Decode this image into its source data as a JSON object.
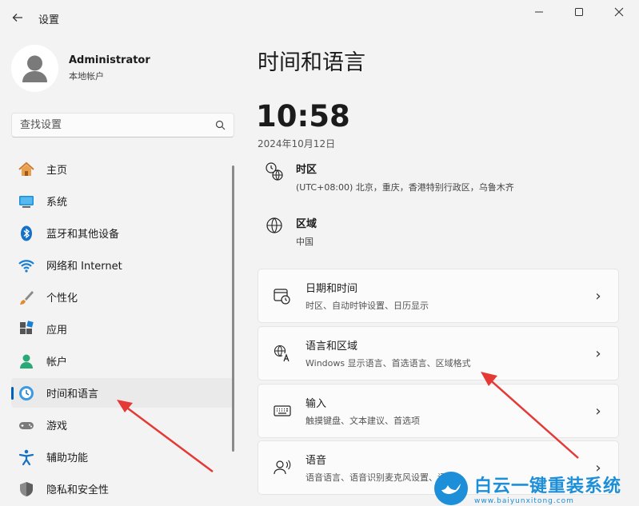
{
  "window": {
    "title": "设置",
    "controls": [
      "minimize",
      "maximize",
      "close"
    ]
  },
  "profile": {
    "name": "Administrator",
    "account_type": "本地帐户"
  },
  "search": {
    "placeholder": "查找设置"
  },
  "sidebar": {
    "items": [
      {
        "label": "主页",
        "icon": "home-icon",
        "active": false
      },
      {
        "label": "系统",
        "icon": "monitor-icon",
        "active": false
      },
      {
        "label": "蓝牙和其他设备",
        "icon": "bluetooth-icon",
        "active": false
      },
      {
        "label": "网络和 Internet",
        "icon": "wifi-icon",
        "active": false
      },
      {
        "label": "个性化",
        "icon": "brush-icon",
        "active": false
      },
      {
        "label": "应用",
        "icon": "apps-icon",
        "active": false
      },
      {
        "label": "帐户",
        "icon": "person-icon",
        "active": false
      },
      {
        "label": "时间和语言",
        "icon": "globe-clock-icon",
        "active": true
      },
      {
        "label": "游戏",
        "icon": "gamepad-icon",
        "active": false
      },
      {
        "label": "辅助功能",
        "icon": "accessibility-icon",
        "active": false
      },
      {
        "label": "隐私和安全性",
        "icon": "shield-icon",
        "active": false
      }
    ]
  },
  "main": {
    "title": "时间和语言",
    "time": "10:58",
    "date": "2024年10月12日",
    "timezone": {
      "title": "时区",
      "value": "(UTC+08:00) 北京，重庆，香港特别行政区，乌鲁木齐"
    },
    "region": {
      "title": "区域",
      "value": "中国"
    },
    "cards": [
      {
        "title": "日期和时间",
        "subtitle": "时区、自动时钟设置、日历显示",
        "icon": "calendar-clock-icon"
      },
      {
        "title": "语言和区域",
        "subtitle": "Windows 显示语言、首选语言、区域格式",
        "icon": "language-icon"
      },
      {
        "title": "输入",
        "subtitle": "触摸键盘、文本建议、首选项",
        "icon": "keyboard-icon"
      },
      {
        "title": "语音",
        "subtitle": "语音语言、语音识别麦克风设置、语音",
        "icon": "speech-icon"
      }
    ]
  },
  "watermark": {
    "name": "白云一键重装系统",
    "url": "www.baiyunxitong.com"
  },
  "colors": {
    "accent": "#005fb8",
    "annotation": "#e53935",
    "watermark": "#1d8ed8"
  }
}
